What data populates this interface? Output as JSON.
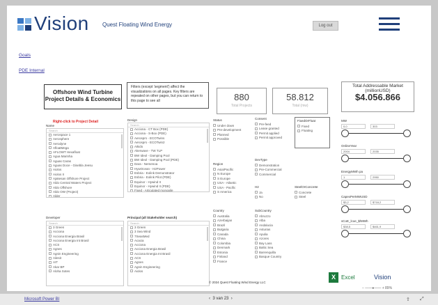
{
  "header": {
    "logo_text": "Vision",
    "app_name": "Quest Floating Wind Energy",
    "login_label": "Log out",
    "menu_icon": "hamburger-icon"
  },
  "links": {
    "goals": "Goals",
    "pde_internal": "PDE Internal"
  },
  "title_box": {
    "line1": "Offshore Wind Turbine",
    "line2": "Project Details & Economics"
  },
  "note": "Filters (except 'segment') affect the visualizations on all pages. Key filters are repeated on other pages, but you can return to this page to see all",
  "cards": {
    "projects_value": "880",
    "projects_label": "Total Projects",
    "mw_value": "58.812",
    "mw_label": "Total (mw)",
    "tam_label1": "Total Addressable Market",
    "tam_label2": "(millionUSD)",
    "tam_value": "$4.056.866"
  },
  "right_click_hint": "Right-click to Project Detail",
  "name_slicer": {
    "label": "Name",
    "search": "Search",
    "items": [
      "Aerospace 1",
      "Aerosphere",
      "Aerodyne",
      "AfloatMega",
      "AFLOWT Hexafloat",
      "Agua Marinha",
      "Aguas Caras",
      "Aguas Doce - Gisebla Jeesu",
      "Aiolos",
      "Aiolos II",
      "Ajakesan Offshore Project",
      "Aldo Central Waters Project",
      "Aldo Offshore",
      "Aldo OW (Project)",
      "Alder"
    ]
  },
  "design_slicer": {
    "label": "Design",
    "search": "Search",
    "items": [
      "Acciona - CT Box (PDE)",
      "Acciona - S-Box (PDE)",
      "Aerosprs - ECOTwins",
      "Aerosprs - ECOTwin2",
      "Aikido",
      "Akerwave - TW TLP",
      "BW Ideol - Damping Pool",
      "BW Ideol - Damping Pool (PDE)",
      "Dara - Nemenoa",
      "HywOcean - H2Power",
      "Esbria - Eolink Demonstrator",
      "Esbria - Eolink Pilot (PDE)",
      "Equinor - Hywind II",
      "Equinor - Hywind II (PDE)",
      "Fixed - Articulated monopile"
    ]
  },
  "status": {
    "label": "Status",
    "items": [
      "Under down",
      "Pre-development",
      "Planned",
      "Possible"
    ]
  },
  "consent": {
    "label": "Consent",
    "items": [
      "Pre-feed",
      "Lease granted",
      "Permit applied",
      "Permit approved"
    ]
  },
  "fixed_or_float": {
    "label": "FixedOrFloat",
    "items": [
      "Fixed",
      "Floating"
    ]
  },
  "region": {
    "label": "Region",
    "items": [
      "Asia/Pacific",
      "N Europe",
      "S Europe",
      "USA - Atlantic",
      "USA - Pacific",
      "S America"
    ]
  },
  "dev_type": {
    "label": "DevType",
    "items": [
      "Demonstration",
      "Pre-Commercial",
      "Commercial"
    ]
  },
  "h2": {
    "label": "H2",
    "items": [
      "Ja",
      "No"
    ]
  },
  "steel_or_concrete": {
    "label": "SteelOrConcrete",
    "items": [
      "Concrete",
      "Steel"
    ]
  },
  "country": {
    "label": "Country",
    "items": [
      "Australia",
      "Azerbaijan",
      "Brazil",
      "Bulgaria",
      "Canada",
      "China",
      "Colombia",
      "Denmark",
      "Estonia",
      "Finland",
      "France"
    ]
  },
  "subcountry": {
    "label": "SubCountry",
    "items": [
      "Abruzzo",
      "Alba",
      "Andalucia",
      "Asturias",
      "Apulia",
      "Azores",
      "Bay Lass",
      "Baltic Sea",
      "Barrenquilla",
      "Basque Country"
    ]
  },
  "developer": {
    "label": "Developer",
    "search": "Search",
    "items": [
      "3 Green",
      "Acciona",
      "Acciona Energia Brasil",
      "Acciona Energia Int Brasil",
      "ACS",
      "Agnes",
      "Agnin Engineering",
      "Ailesit",
      "AIT",
      "Akar BP",
      "Aloha Sotes"
    ]
  },
  "principal": {
    "label": "Principal (all Stakeholder search)",
    "search": "Search",
    "items": [
      "3 Green",
      "3 Sea Wind",
      "7SeasMed",
      "Acacia",
      "Acciona",
      "Acciona Energia Brasil",
      "Acciona Energia Int Brasil",
      "ACS",
      "Agnes",
      "Agnin Engineering",
      "Aiolos"
    ]
  },
  "ranges": [
    {
      "label": "MW",
      "min": "0,0",
      "max": "303"
    },
    {
      "label": "OnlineYear",
      "min": "2004",
      "max": "2035"
    },
    {
      "label": "EnergyMWh pa",
      "min": "1",
      "max": "2950"
    },
    {
      "label": "CapexPerMWUSD",
      "min": "$3,2",
      "max": "$718,2"
    },
    {
      "label": "sCoE_lcoe_$/MWh",
      "min": "$38,5",
      "max": "$461,9"
    }
  ],
  "copyright": "© 2024 Quest Floating Wind Energy LLC",
  "footer_logos": {
    "excel": "Excel",
    "vision": "Vision"
  },
  "zoom": "89%",
  "statusbar": {
    "product": "Microsoft Power BI",
    "page": "3 van 23"
  }
}
